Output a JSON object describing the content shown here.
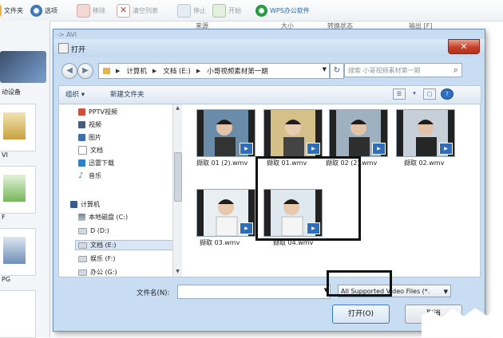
{
  "app": {
    "toolbar": [
      {
        "label": "文件夹",
        "icon": "folder-icon",
        "disabled": false
      },
      {
        "label": "选项",
        "icon": "options-icon",
        "disabled": false
      },
      {
        "label": "移除",
        "icon": "remove-icon",
        "disabled": true
      },
      {
        "label": "清空列表",
        "icon": "clear-list-icon",
        "disabled": true
      },
      {
        "label": "停止",
        "icon": "stop-icon",
        "disabled": true
      },
      {
        "label": "开始",
        "icon": "start-icon",
        "disabled": true
      },
      {
        "label": "WPS办公软件",
        "icon": "wps-icon",
        "disabled": false
      }
    ],
    "header_cols": [
      "来源",
      "大小",
      "转换状态",
      "输出 [F]"
    ],
    "device_label": "动设备",
    "formats": [
      "VI",
      "F",
      "PG"
    ]
  },
  "dialog": {
    "parent_title": "-> AVI",
    "title": "打开",
    "close_label": "✕",
    "address": {
      "crumbs": [
        "计算机",
        "文档 (E:)",
        "小哥视频素材第一期"
      ]
    },
    "search_placeholder": "搜索 小哥视频素材第一期",
    "commands": {
      "organize": "组织 ▾",
      "new_folder": "新建文件夹"
    },
    "nav_items": [
      {
        "label": "PPTV视频",
        "icon": "pptv-video-icon",
        "color": "#d04f3a"
      },
      {
        "label": "视频",
        "icon": "video-library-icon",
        "color": "#4a5d78"
      },
      {
        "label": "图片",
        "icon": "pictures-icon",
        "color": "#3f6fa8"
      },
      {
        "label": "文档",
        "icon": "documents-icon",
        "color": "#8a9bb2"
      },
      {
        "label": "迅雷下载",
        "icon": "thunder-download-icon",
        "color": "#2f7fd0"
      },
      {
        "label": "音乐",
        "icon": "music-icon",
        "color": "#3a7bc8"
      },
      {
        "label": "计算机",
        "icon": "computer-icon",
        "color": "#3a5a8a"
      },
      {
        "label": "本地磁盘 (C:)",
        "icon": "local-disk-icon",
        "color": "#7d8590"
      },
      {
        "label": "D (D:)",
        "icon": "drive-icon",
        "color": "#9aa1aa"
      },
      {
        "label": "文档 (E:)",
        "icon": "drive-icon",
        "color": "#9aa1aa"
      },
      {
        "label": "娱乐 (F:)",
        "icon": "drive-icon",
        "color": "#9aa1aa"
      },
      {
        "label": "办公 (G:)",
        "icon": "drive-icon",
        "color": "#9aa1aa"
      }
    ],
    "files": [
      {
        "name": "撷取 01 (2).wmv"
      },
      {
        "name": "撷取 01.wmv"
      },
      {
        "name": "撷取 02 (2).wmv"
      },
      {
        "name": "撷取 02.wmv"
      },
      {
        "name": "撷取 03.wmv"
      },
      {
        "name": "撷取 04.wmv"
      }
    ],
    "filename_label": "文件名(N):",
    "filename_value": "",
    "filetype": "All Supported Video Files (*.",
    "open_label": "打开(O)",
    "cancel_label": "取消"
  },
  "colors": {
    "accent": "#3d7bbf",
    "dialog_frame": "#c9ddf2",
    "close": "#c6412a"
  }
}
